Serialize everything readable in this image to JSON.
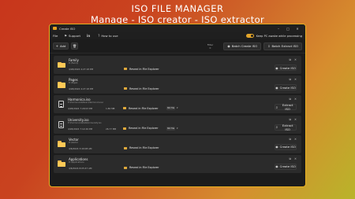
{
  "banner": {
    "title": "ISO FILE MANAGER",
    "subtitle": "Manage - ISO creator - ISO extractor"
  },
  "window": {
    "title": "Create ISO",
    "controls": [
      "–",
      "□",
      "✕"
    ]
  },
  "menu": {
    "file": "File",
    "support": "Support",
    "how_to_use": "How to use",
    "keep_awake": "Keep PC awake while processing",
    "keep_awake_on": true
  },
  "toolbar": {
    "add": "Add",
    "filter_label": "Filter",
    "filter_value": "0",
    "batch_create": "Batch Create ISO",
    "batch_extract": "Batch Extract ISO"
  },
  "items": [
    {
      "name": "Family",
      "path": "D:\\Family",
      "date": "4/26/2024 4:27:18 PM",
      "size": "",
      "badge": "",
      "reveal": "Reveal in File Explorer",
      "action": "Create ISO",
      "kind": "folder"
    },
    {
      "name": "Pages",
      "path": "D:\\Pages",
      "date": "4/26/2024 4:27:18 PM",
      "size": "",
      "badge": "",
      "reveal": "Reveal in File Explorer",
      "action": "Create ISO",
      "kind": "folder"
    },
    {
      "name": "Harmonica.iso",
      "path": "E:\\Harmonica\\Music\\Harmonica.iso",
      "date": "4/26/2024 7:29:03 PM",
      "size": "1.80 MB",
      "badge": "ISO file",
      "reveal": "Reveal in File Explorer",
      "action": "Extract ISO",
      "kind": "file"
    },
    {
      "name": "University.iso",
      "path": "E:\\Harmonica\\Data\\University.iso",
      "date": "4/26/2024 7:12:49 PM",
      "size": "26.77 MB",
      "badge": "ISO file",
      "reveal": "Reveal in File Explorer",
      "action": "Extract ISO",
      "kind": "file"
    },
    {
      "name": "Vector",
      "path": "D:\\Vector",
      "date": "4/6/2024 3:49:08 AM",
      "size": "",
      "badge": "",
      "reveal": "Reveal in File Explorer",
      "action": "Create ISO",
      "kind": "folder"
    },
    {
      "name": "Applications",
      "path": "D:\\Applications",
      "date": "4/6/2024 8:05:47 AM",
      "size": "",
      "badge": "",
      "reveal": "Reveal in File Explorer",
      "action": "Create ISO",
      "kind": "folder"
    }
  ],
  "colors": {
    "accent": "#e8b020",
    "folder": "#ffc956",
    "window_bg": "#1c1c1c",
    "card_bg": "#2b2b2b"
  }
}
